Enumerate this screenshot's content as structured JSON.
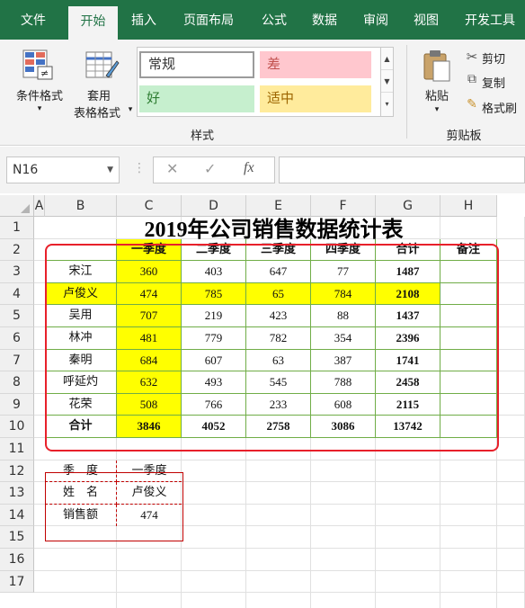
{
  "menu_tabs": [
    "文件",
    "开始",
    "插入",
    "页面布局",
    "公式",
    "数据",
    "审阅",
    "视图",
    "开发工具"
  ],
  "active_tab": "开始",
  "ribbon": {
    "conditional_format": "条件格式",
    "table_format_line1": "套用",
    "table_format_line2": "表格格式",
    "styles_group": "样式",
    "style_normal": "常规",
    "style_bad": "差",
    "style_good": "好",
    "style_neutral": "适中",
    "paste": "粘贴",
    "cut": "剪切",
    "copy": "复制",
    "format_painter": "格式刷",
    "clipboard_group": "剪贴板"
  },
  "formula_bar": {
    "name_box": "N16",
    "fx": "fx",
    "value": ""
  },
  "columns": [
    "A",
    "B",
    "C",
    "D",
    "E",
    "F",
    "G",
    "H"
  ],
  "rows": [
    "1",
    "2",
    "3",
    "4",
    "5",
    "6",
    "7",
    "8",
    "9",
    "10",
    "11",
    "12",
    "13",
    "14",
    "15",
    "16",
    "17"
  ],
  "title": "2019年公司销售数据统计表",
  "table": {
    "headers": [
      "",
      "一季度",
      "二季度",
      "三季度",
      "四季度",
      "合计",
      "备注"
    ],
    "rows": [
      [
        "宋江",
        "360",
        "403",
        "647",
        "77",
        "1487",
        ""
      ],
      [
        "卢俊义",
        "474",
        "785",
        "65",
        "784",
        "2108",
        ""
      ],
      [
        "吴用",
        "707",
        "219",
        "423",
        "88",
        "1437",
        ""
      ],
      [
        "林冲",
        "481",
        "779",
        "782",
        "354",
        "2396",
        ""
      ],
      [
        "秦明",
        "684",
        "607",
        "63",
        "387",
        "1741",
        ""
      ],
      [
        "呼延灼",
        "632",
        "493",
        "545",
        "788",
        "2458",
        ""
      ],
      [
        "花荣",
        "508",
        "766",
        "233",
        "608",
        "2115",
        ""
      ]
    ],
    "total": [
      "合计",
      "3846",
      "4052",
      "2758",
      "3086",
      "13742",
      ""
    ]
  },
  "lookup": {
    "row1": [
      "季　度",
      "一季度"
    ],
    "row2": [
      "姓　名",
      "卢俊义"
    ],
    "row3": [
      "销售额",
      "474"
    ]
  },
  "colors": {
    "brand": "#217346",
    "highlight_yellow": "#ffff00",
    "bad_fill": "#ffc7ce",
    "good_fill": "#c6efce",
    "neutral_fill": "#ffeb9c",
    "table_border": "#e8202a",
    "grid_green": "#70ad47"
  }
}
